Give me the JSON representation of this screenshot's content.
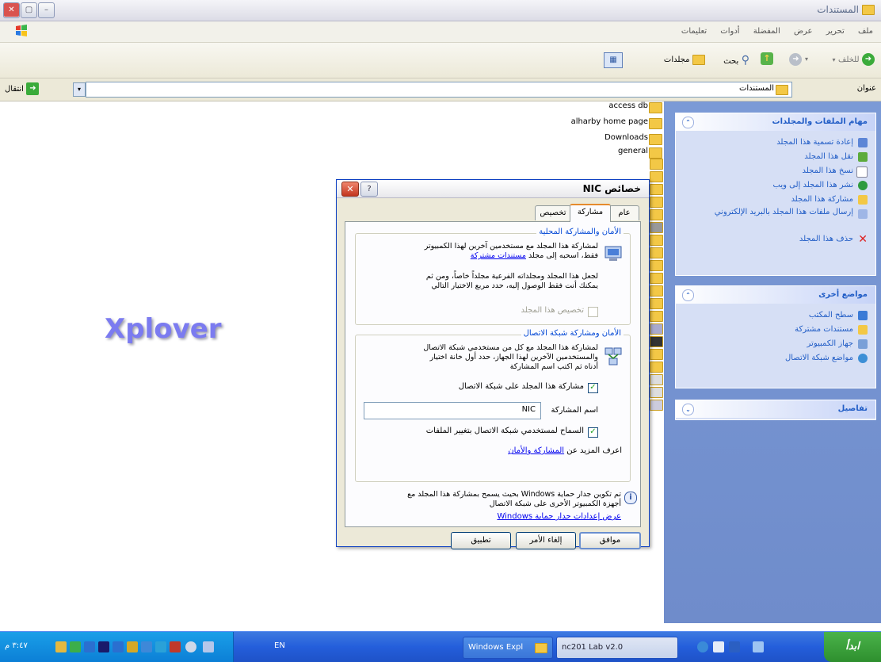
{
  "window": {
    "title": "المستندات"
  },
  "menu": {
    "items": [
      "ملف",
      "تحرير",
      "عرض",
      "المفضلة",
      "أدوات",
      "تعليمات"
    ]
  },
  "toolbar": {
    "back_label": "للخلف",
    "search_label": "بحث",
    "folders_label": "مجلدات"
  },
  "address": {
    "label": "عنوان",
    "value": "المستندات",
    "go_label": "انتقال"
  },
  "files": [
    {
      "name": "access db"
    },
    {
      "name": "alharby home page"
    },
    {
      "name": "Downloads"
    },
    {
      "name": "general"
    }
  ],
  "taskpane": {
    "tasks_title": "مهام الملفات والمجلدات",
    "tasks": [
      "إعادة تسمية هذا المجلد",
      "نقل هذا المجلد",
      "نسخ هذا المجلد",
      "نشر هذا المجلد إلى ويب",
      "مشاركة هذا المجلد",
      "إرسال ملفات هذا المجلد بالبريد الإلكتروني",
      "حذف هذا المجلد"
    ],
    "places_title": "مواضع أخرى",
    "places": [
      "سطح المكتب",
      "مستندات مشتركة",
      "جهاز الكمبيوتر",
      "مواضع شبكة الاتصال"
    ],
    "details_title": "تفاصيل"
  },
  "watermark": "Xplover",
  "dialog": {
    "title": "خصائص NIC",
    "tabs": [
      "عام",
      "مشاركة",
      "تخصيص"
    ],
    "local": {
      "title": "الأمان والمشاركة المحلية",
      "line1": "لمشاركة هذا المجلد مع مستخدمين آخرين لهذا الكمبيوتر",
      "line2_prefix": "فقط، اسحبه إلى مجلد",
      "link": "مستندات مشتركة",
      "para2_line1": "لجعل هذا المجلد ومجلداته الفرعية مجلداً خاصاً، ومن ثم",
      "para2_line2": "يمكنك أنت فقط الوصول إليه، حدد مربع الاختيار التالي",
      "make_private": "تخصيص هذا المجلد"
    },
    "network": {
      "title": "الأمان ومشاركة شبكة الاتصال",
      "line1": "لمشاركة هذا المجلد مع كل من مستخدمي شبكة الاتصال",
      "line2": "والمستخدمين الآخرين لهذا الجهاز، حدد أول خانة اختيار",
      "line3": "أدناه ثم اكتب اسم المشاركة",
      "share_check": "مشاركة هذا المجلد على شبكة الاتصال",
      "share_name_label": "اسم المشاركة",
      "share_name_value": "NIC",
      "allow_change": "السماح لمستخدمي شبكة الاتصال بتغيير الملفات",
      "learn_prefix": "اعرف المزيد عن",
      "learn_link": "المشاركة والأمان"
    },
    "firewall": {
      "line1": "تم تكوين جدار حماية Windows بحيث يسمح بمشاركة هذا المجلد مع",
      "line2": "أجهزة الكمبيوتر الأخرى على شبكة الاتصال",
      "link": "عرض إعدادات جدار حماية Windows"
    },
    "buttons": {
      "ok": "موافق",
      "cancel": "إلغاء الأمر",
      "apply": "تطبيق"
    }
  },
  "taskbar": {
    "start": "ابدأ",
    "tasks": [
      "Windows Expl",
      "nc201 Lab v2.0"
    ],
    "lang": "EN",
    "clock": "٣:٤٧ م"
  }
}
